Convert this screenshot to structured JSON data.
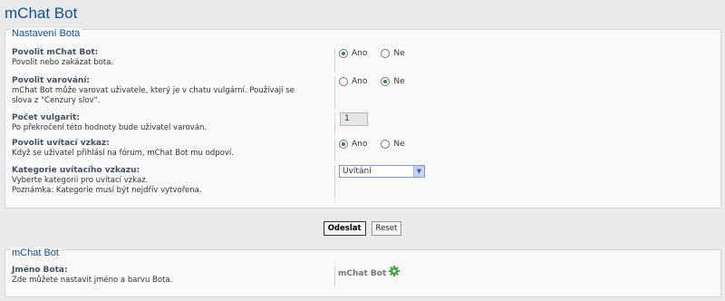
{
  "page": {
    "title": "mChat Bot"
  },
  "settings": {
    "legend": "Nastavení Bota",
    "rows": [
      {
        "label": "Povolit mChat Bot:",
        "explain": [
          "Povolit nebo zakázat bota."
        ],
        "options": [
          "Ano",
          "Ne"
        ],
        "selected": "Ano"
      },
      {
        "label": "Povolit varování:",
        "explain": [
          "mChat Bot může varovat uživatele, který je v chatu vulgární. Používají se",
          "slova z \"Cenzury slov\"."
        ],
        "options": [
          "Ano",
          "Ne"
        ],
        "selected": "Ne"
      },
      {
        "label": "Počet vulgarit:",
        "explain": [
          "Po překročení této hodnoty bude uživatel varován."
        ],
        "value": "1"
      },
      {
        "label": "Povolit uvítací vzkaz:",
        "explain": [
          "Když se uživatel přihlásí na fórum, mChat Bot mu odpoví."
        ],
        "options": [
          "Ano",
          "Ne"
        ],
        "selected": "Ano"
      },
      {
        "label": "Kategorie uvítacího vzkazu:",
        "explain": [
          "Vyberte kategorii pro uvítací vzkaz.",
          "Poznámka: Kategorie musí být nejdřív vytvořena."
        ],
        "select_value": "Uvítání"
      }
    ]
  },
  "buttons": {
    "submit": "Odeslat",
    "reset": "Reset"
  },
  "bot": {
    "legend": "mChat Bot",
    "label": "Jméno Bota:",
    "explain": [
      "Zde můžete nastavit jméno a barvu Bota."
    ],
    "name_value": "mChat Bot",
    "icon": "gear-icon"
  },
  "colors": {
    "title": "#115098",
    "radio_selected": "#2a8a3a",
    "gear": "#3fa63a"
  }
}
